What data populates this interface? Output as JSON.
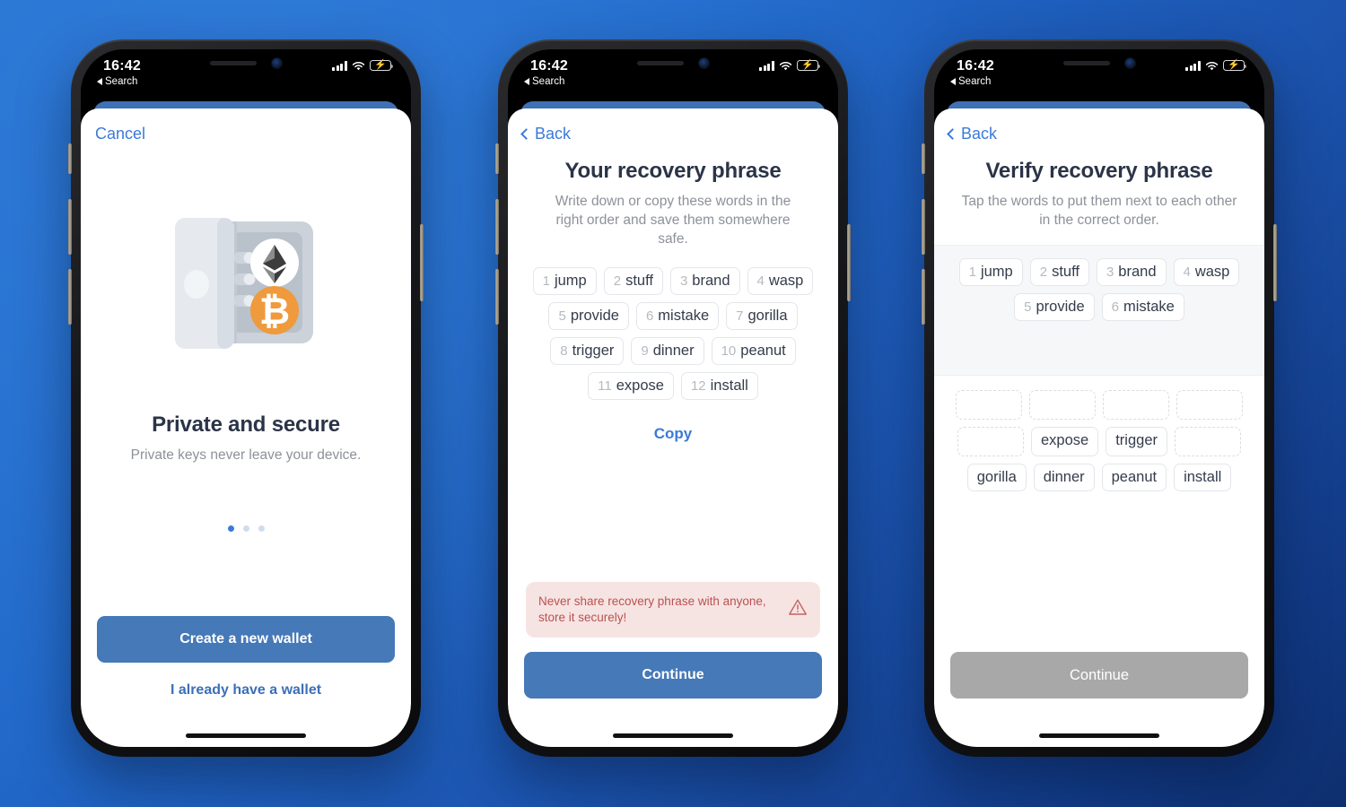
{
  "background": {
    "color_top_left": "#2671d0",
    "color_bottom_right": "#0e2f6e"
  },
  "theme": {
    "accent_blue": "#3b7ad9",
    "button_blue": "#4579b7",
    "button_disabled_gray": "#a8a8a8",
    "warning_bg": "#f6e4e3",
    "warning_text": "#b9524f",
    "heading_color": "#2b3447",
    "subtext_color": "#8d9199",
    "panel_bg": "#f6f7f8",
    "bitcoin_orange": "#ef9a3d"
  },
  "status_bar": {
    "time": "16:42",
    "back_label": "Search",
    "back_icon": "triangle-left-icon",
    "signal_icon": "cellular-bars-icon",
    "wifi_icon": "wifi-icon",
    "battery_icon": "battery-charging-icon",
    "battery_bolt": "⚡"
  },
  "screens": [
    {
      "id": "onboarding",
      "nav": {
        "label": "Cancel",
        "has_chevron": false
      },
      "illustration": "safe-with-crypto-coins-illustration",
      "coins": [
        {
          "name": "ethereum-coin-icon"
        },
        {
          "name": "bitcoin-coin-icon",
          "symbol": "₿"
        }
      ],
      "title": "Private and secure",
      "subtitle": "Private keys never leave your device.",
      "pager": {
        "total": 3,
        "active": 1
      },
      "primary_button": "Create a new wallet",
      "secondary_button": "I already have a wallet"
    },
    {
      "id": "recovery-phrase",
      "nav": {
        "label": "Back",
        "has_chevron": true
      },
      "title": "Your recovery phrase",
      "subtitle": "Write down or copy these words in the right order and save them somewhere safe.",
      "words": [
        {
          "num": "1",
          "word": "jump"
        },
        {
          "num": "2",
          "word": "stuff"
        },
        {
          "num": "3",
          "word": "brand"
        },
        {
          "num": "4",
          "word": "wasp"
        },
        {
          "num": "5",
          "word": "provide"
        },
        {
          "num": "6",
          "word": "mistake"
        },
        {
          "num": "7",
          "word": "gorilla"
        },
        {
          "num": "8",
          "word": "trigger"
        },
        {
          "num": "9",
          "word": "dinner"
        },
        {
          "num": "10",
          "word": "peanut"
        },
        {
          "num": "11",
          "word": "expose"
        },
        {
          "num": "12",
          "word": "install"
        }
      ],
      "copy_link": "Copy",
      "warning": {
        "text": "Never share recovery phrase with anyone, store it securely!",
        "icon": "warning-triangle-icon"
      },
      "primary_button": "Continue"
    },
    {
      "id": "verify-recovery-phrase",
      "nav": {
        "label": "Back",
        "has_chevron": true
      },
      "title": "Verify recovery phrase",
      "subtitle": "Tap the words to put them next to each other in the correct order.",
      "selected_words": [
        {
          "num": "1",
          "word": "jump"
        },
        {
          "num": "2",
          "word": "stuff"
        },
        {
          "num": "3",
          "word": "brand"
        },
        {
          "num": "4",
          "word": "wasp"
        },
        {
          "num": "5",
          "word": "provide"
        },
        {
          "num": "6",
          "word": "mistake"
        }
      ],
      "pool_rows": [
        [
          {
            "empty": true
          },
          {
            "empty": true
          },
          {
            "empty": true
          },
          {
            "empty": true
          }
        ],
        [
          {
            "empty": true
          },
          {
            "word": "expose"
          },
          {
            "word": "trigger"
          },
          {
            "empty": true
          }
        ],
        [
          {
            "word": "gorilla"
          },
          {
            "word": "dinner"
          },
          {
            "word": "peanut"
          },
          {
            "word": "install"
          }
        ]
      ],
      "primary_button": "Continue",
      "primary_button_disabled": true
    }
  ]
}
